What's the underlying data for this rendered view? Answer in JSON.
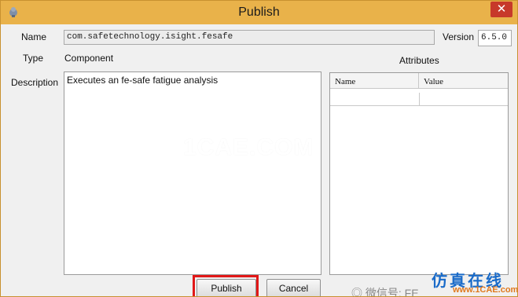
{
  "window": {
    "title": "Publish"
  },
  "form": {
    "name_label": "Name",
    "name_value": "com.safetechnology.isight.fesafe",
    "version_label": "Version",
    "version_value": "6.5.0",
    "type_label": "Type",
    "type_value": "Component",
    "attributes_label": "Attributes",
    "description_label": "Description",
    "description_value": "Executes an fe-safe fatigue analysis"
  },
  "attributes_table": {
    "columns": [
      "Name",
      "Value"
    ],
    "rows": [
      [
        "",
        ""
      ]
    ]
  },
  "buttons": {
    "publish": "Publish",
    "cancel": "Cancel"
  },
  "overlays": {
    "center_watermark": "1CAE.COM",
    "wechat_text": "微信号: FE",
    "cn_text": "仿真在线",
    "site_text": "www.1CAE.com"
  },
  "colors": {
    "titlebar": "#e9b24a",
    "close_button": "#c7392a",
    "highlight": "#e11818"
  }
}
